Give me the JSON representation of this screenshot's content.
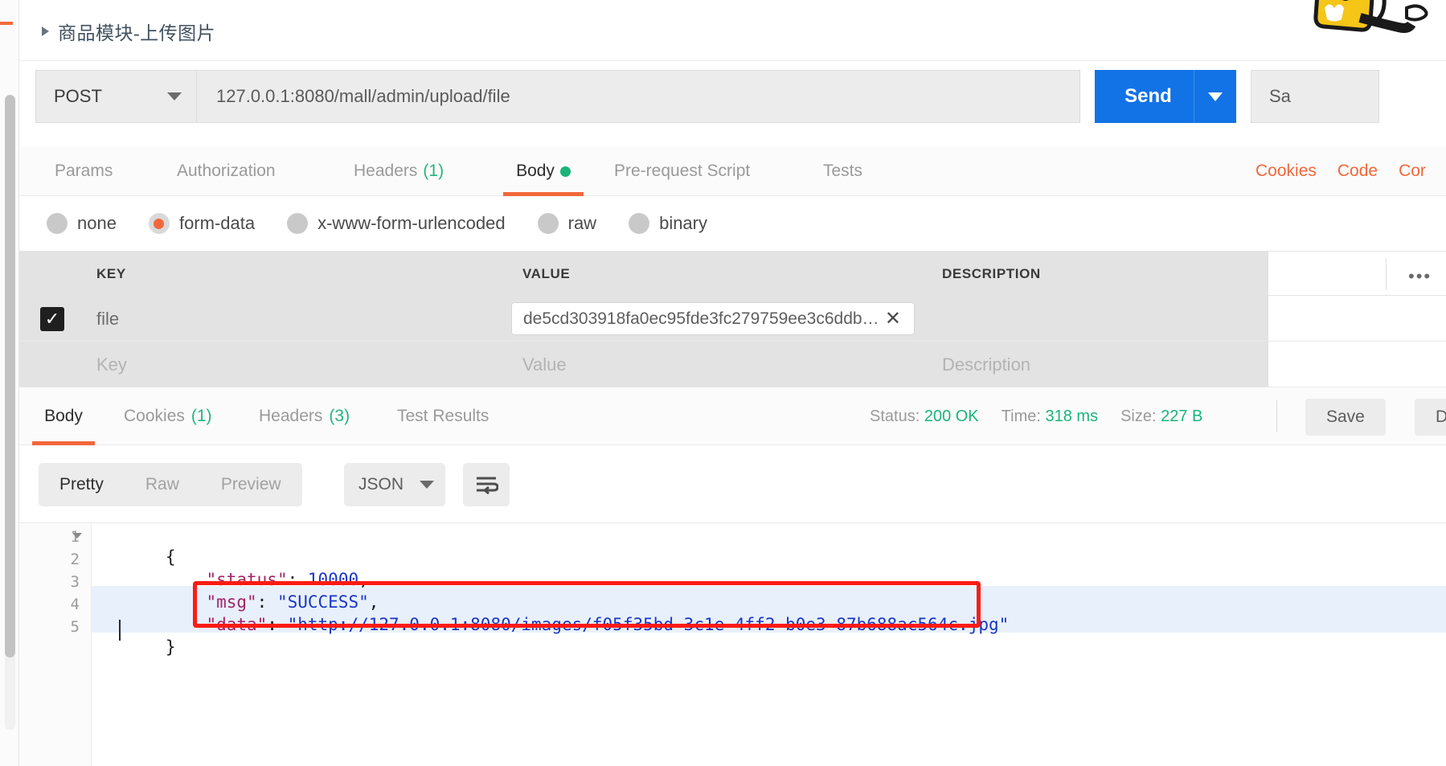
{
  "breadcrumb": {
    "caret_icon": "triangle-right-icon",
    "text": "商品模块-上传图片"
  },
  "request": {
    "method": "POST",
    "method_caret_icon": "chevron-down-icon",
    "url": "127.0.0.1:8080/mall/admin/upload/file",
    "send_label": "Send",
    "send_caret_icon": "chevron-down-icon",
    "save_label": "Sa"
  },
  "request_tabs": [
    {
      "label": "Params",
      "count": "",
      "active": false
    },
    {
      "label": "Authorization",
      "count": "",
      "active": false
    },
    {
      "label": "Headers",
      "count": "(1)",
      "active": false
    },
    {
      "label": "Body",
      "count": "",
      "active": true,
      "dot": true
    },
    {
      "label": "Pre-request Script",
      "count": "",
      "active": false
    },
    {
      "label": "Tests",
      "count": "",
      "active": false
    }
  ],
  "request_links": [
    {
      "label": "Cookies"
    },
    {
      "label": "Code"
    },
    {
      "label": "Cor"
    }
  ],
  "body_types": [
    {
      "label": "none",
      "selected": false
    },
    {
      "label": "form-data",
      "selected": true
    },
    {
      "label": "x-www-form-urlencoded",
      "selected": false
    },
    {
      "label": "raw",
      "selected": false
    },
    {
      "label": "binary",
      "selected": false
    }
  ],
  "kv_table": {
    "headers": {
      "key": "KEY",
      "value": "VALUE",
      "description": "DESCRIPTION"
    },
    "more_icon": "ellipsis-icon",
    "rows": [
      {
        "checked": true,
        "key": "file",
        "value": "de5cd303918fa0ec95fde3fc279759ee3c6ddb…",
        "value_clear_icon": "close-icon",
        "description": ""
      },
      {
        "checked": false,
        "key_placeholder": "Key",
        "value_placeholder": "Value",
        "description_placeholder": "Description"
      }
    ]
  },
  "response_tabs": [
    {
      "label": "Body",
      "count": "",
      "active": true
    },
    {
      "label": "Cookies",
      "count": "(1)",
      "active": false
    },
    {
      "label": "Headers",
      "count": "(3)",
      "active": false
    },
    {
      "label": "Test Results",
      "count": "",
      "active": false
    }
  ],
  "response_status": {
    "status_label": "Status:",
    "status_value": "200 OK",
    "time_label": "Time:",
    "time_value": "318 ms",
    "size_label": "Size:",
    "size_value": "227 B"
  },
  "response_buttons": [
    {
      "label": "Save"
    },
    {
      "label": "Do"
    }
  ],
  "response_toolbar": {
    "views": [
      {
        "label": "Pretty",
        "active": true
      },
      {
        "label": "Raw",
        "active": false
      },
      {
        "label": "Preview",
        "active": false
      }
    ],
    "format": "JSON",
    "format_caret_icon": "chevron-down-icon",
    "wrap_icon": "word-wrap-icon"
  },
  "response_body": {
    "line_numbers": [
      "1",
      "2",
      "3",
      "4",
      "5"
    ],
    "lines": [
      {
        "open": "{"
      },
      {
        "key": "\"status\"",
        "colon": ": ",
        "num": "10000",
        "comma": ","
      },
      {
        "key": "\"msg\"",
        "colon": ": ",
        "str": "\"SUCCESS\"",
        "comma": ","
      },
      {
        "key": "\"data\"",
        "colon": ": ",
        "str": "\"http://127.0.0.1:8080/images/f05f35bd-3c1e-4ff2-b0e3-87b688ac564c.jpg\""
      },
      {
        "close": "}"
      }
    ]
  },
  "colors": {
    "accent_orange": "#f2673a",
    "send_blue": "#1273e6",
    "status_green": "#1ab47a",
    "annotation_red": "#fc1c14"
  }
}
